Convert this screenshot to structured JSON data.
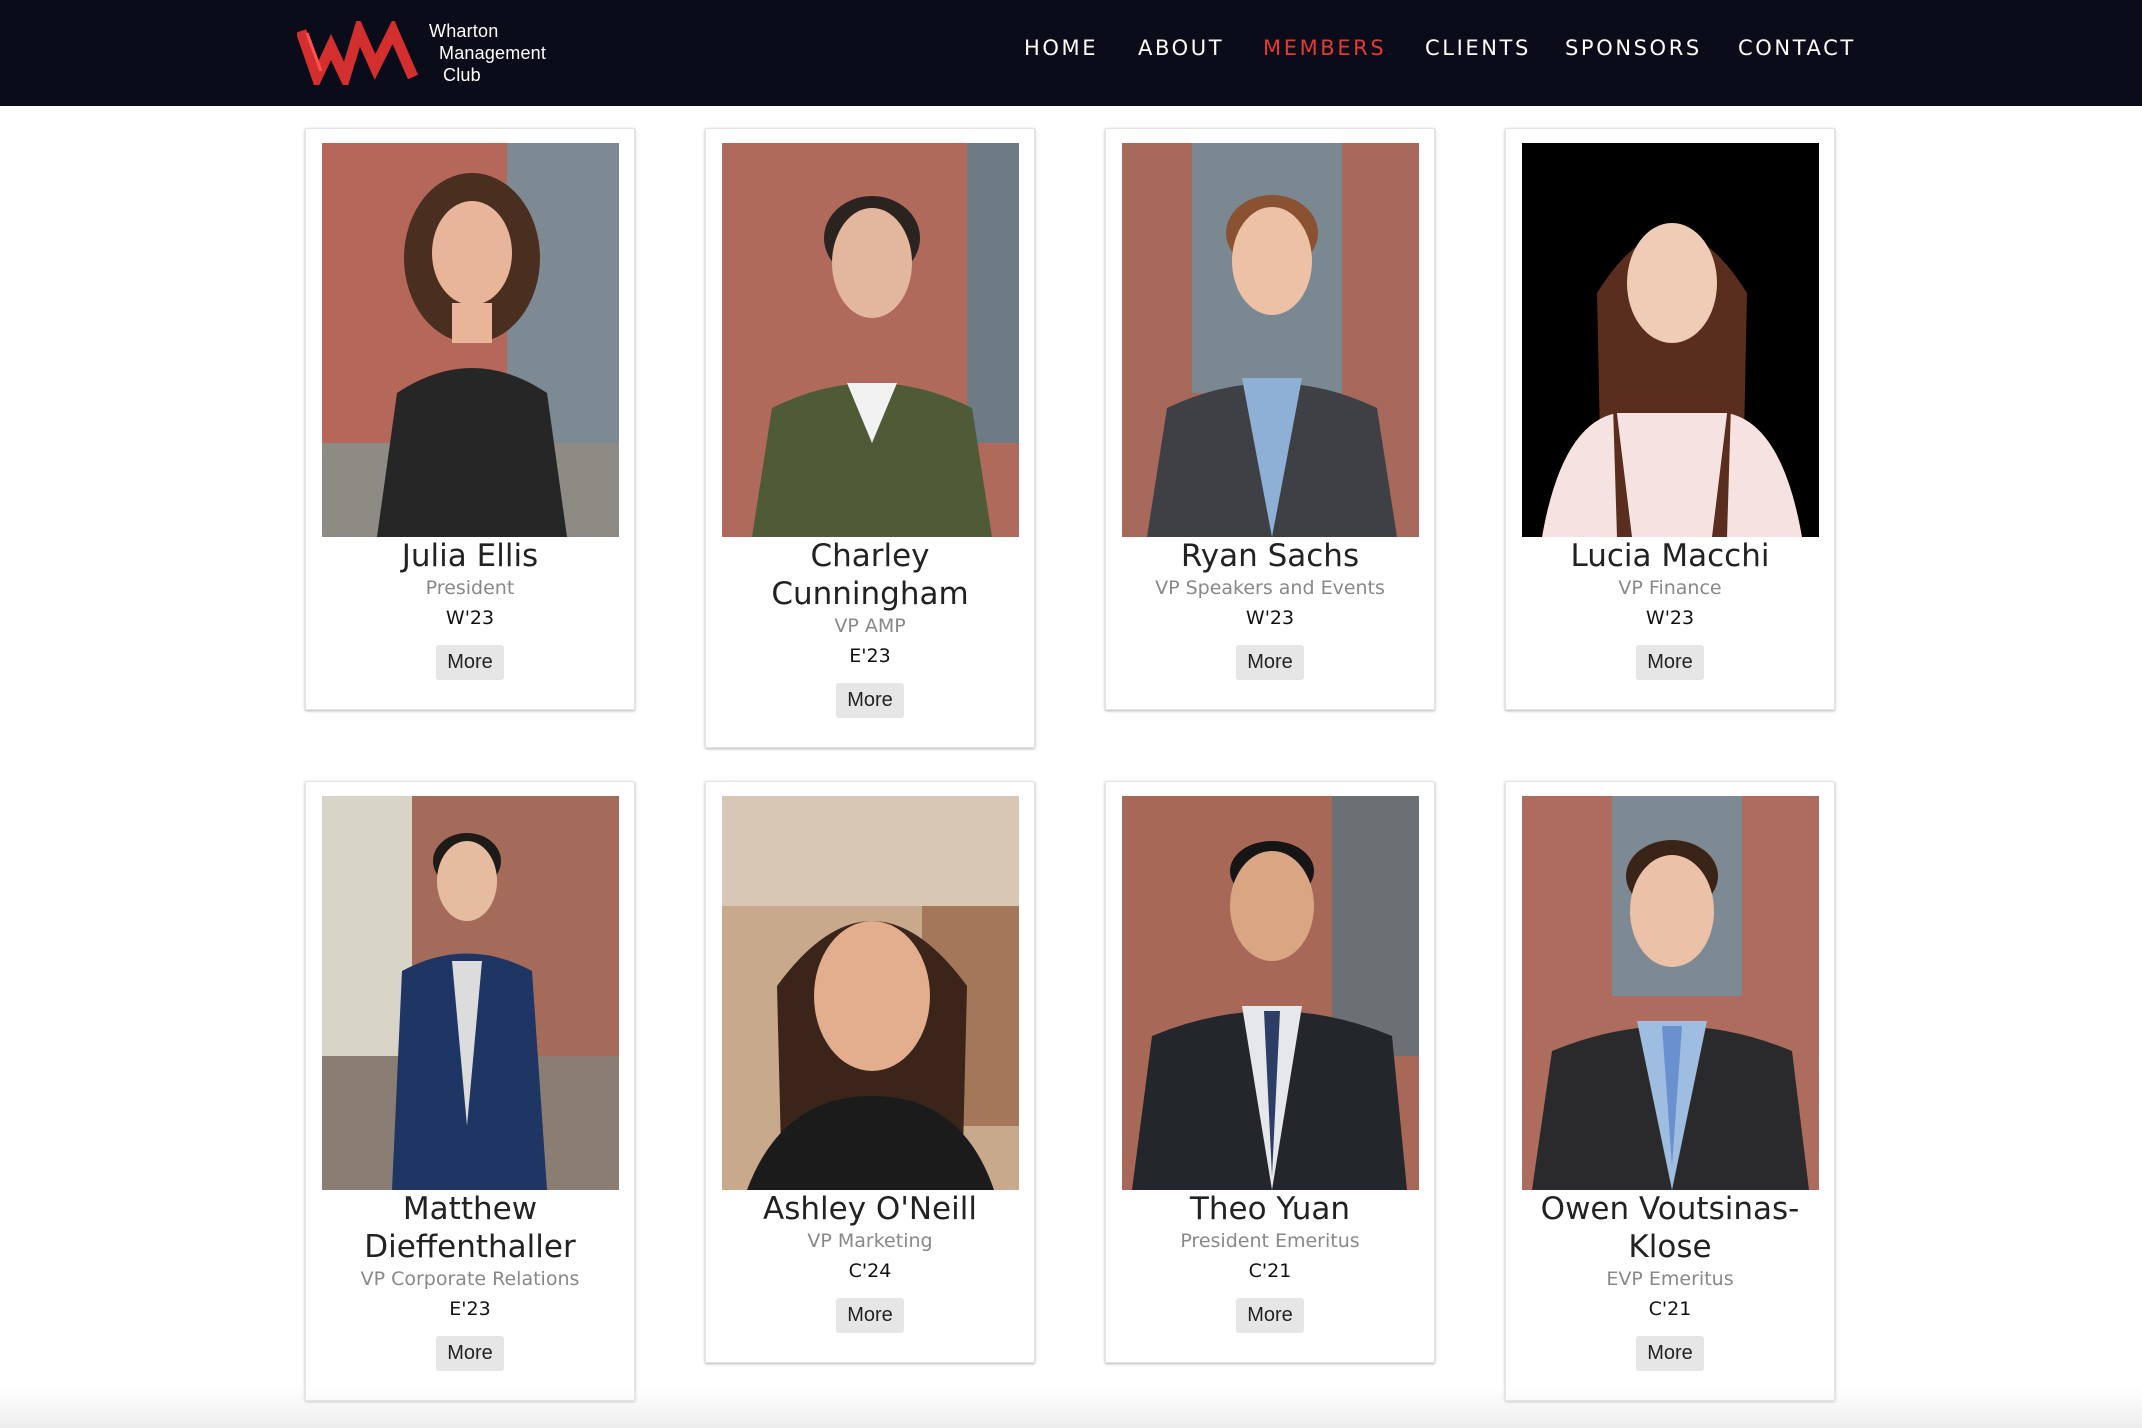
{
  "brand": {
    "line1": "Wharton",
    "line2": "Management",
    "line3": "Club",
    "accent_color": "#e53935",
    "header_bg": "#0b0c1a"
  },
  "nav": {
    "home": "HOME",
    "about": "ABOUT",
    "members": "MEMBERS",
    "clients": "CLIENTS",
    "sponsors": "SPONSORS",
    "contact": "CONTACT",
    "active": "MEMBERS"
  },
  "members": [
    {
      "name": "Julia Ellis",
      "role": "President",
      "year": "W'23",
      "more": "More"
    },
    {
      "name": "Charley Cunningham",
      "role": "VP AMP",
      "year": "E'23",
      "more": "More"
    },
    {
      "name": "Ryan Sachs",
      "role": "VP Speakers and Events",
      "year": "W'23",
      "more": "More"
    },
    {
      "name": "Lucia Macchi",
      "role": "VP Finance",
      "year": "W'23",
      "more": "More"
    },
    {
      "name": "Matthew Dieffenthaller",
      "role": "VP Corporate Relations",
      "year": "E'23",
      "more": "More"
    },
    {
      "name": "Ashley O'Neill",
      "role": "VP Marketing",
      "year": "C'24",
      "more": "More"
    },
    {
      "name": "Theo Yuan",
      "role": "President Emeritus",
      "year": "C'21",
      "more": "More"
    },
    {
      "name": "Owen Voutsinas-Klose",
      "role": "EVP Emeritus",
      "year": "C'21",
      "more": "More"
    }
  ]
}
